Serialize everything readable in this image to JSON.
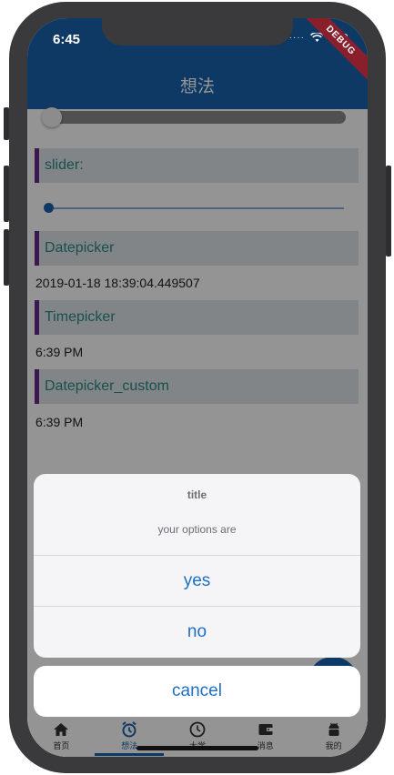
{
  "status_bar": {
    "time": "6:45",
    "signal": "····",
    "debug_label": "DEBUG"
  },
  "app_bar": {
    "title": "想法"
  },
  "content": {
    "slider_label": "slider:",
    "datepicker_label": "Datepicker",
    "datepicker_value": "2019-01-18 18:39:04.449507",
    "timepicker_label": "Timepicker",
    "timepicker_value": "6:39 PM",
    "datepicker_custom_label": "Datepicker_custom",
    "datepicker_custom_value": "6:39 PM"
  },
  "action_sheet": {
    "title": "title",
    "message": "your options are",
    "options": [
      "yes",
      "no"
    ],
    "cancel": "cancel"
  },
  "bottom_nav": {
    "items": [
      {
        "label": "首页",
        "icon": "home-icon"
      },
      {
        "label": "想法",
        "icon": "alarm-icon",
        "active": true
      },
      {
        "label": "大学",
        "icon": "clock-icon"
      },
      {
        "label": "消息",
        "icon": "wallet-icon"
      },
      {
        "label": "我的",
        "icon": "android-icon"
      }
    ]
  },
  "colors": {
    "primary": "#1b63ae",
    "accent_text": "#2a8a83",
    "section_bar": "#6a2a8a",
    "ios_blue": "#1f6fc5"
  }
}
